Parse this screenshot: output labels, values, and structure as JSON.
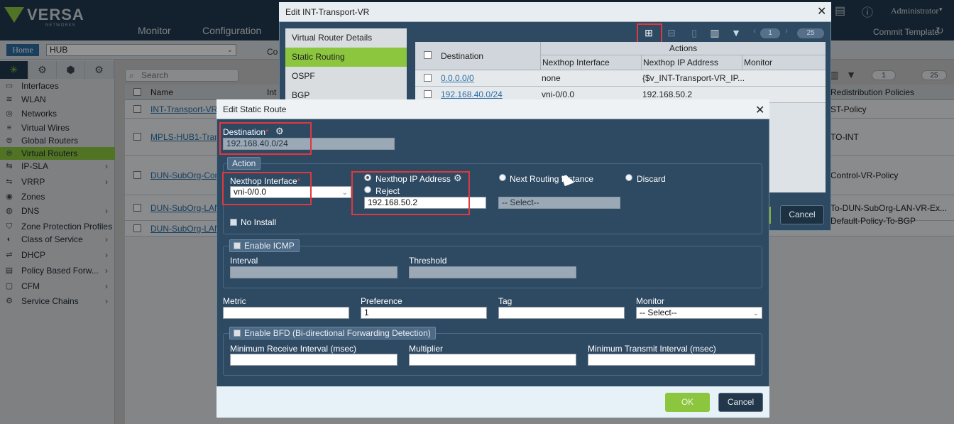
{
  "app": {
    "logo_text": "VERSA",
    "logo_sub": "NETWORKS",
    "nav": [
      "Monitor",
      "Configuration"
    ],
    "user": "Administrator",
    "commit_template": "Commit Template",
    "home": "Home",
    "org": "HUB",
    "context_partial": "Co"
  },
  "sidebar": {
    "items": [
      {
        "label": "Interfaces",
        "icon": "interfaces-icon",
        "expandable": false
      },
      {
        "label": "WLAN",
        "icon": "wifi-icon",
        "expandable": false
      },
      {
        "label": "Networks",
        "icon": "network-icon",
        "expandable": false
      },
      {
        "label": "Virtual Wires",
        "icon": "wire-icon",
        "expandable": false
      },
      {
        "label": "Global Routers",
        "icon": "router-icon",
        "expandable": false
      },
      {
        "label": "Virtual Routers",
        "icon": "router-icon",
        "expandable": false,
        "active": true
      },
      {
        "label": "IP-SLA",
        "icon": "sla-icon",
        "expandable": true
      },
      {
        "label": "VRRP",
        "icon": "vrrp-icon",
        "expandable": true
      },
      {
        "label": "Zones",
        "icon": "zones-icon",
        "expandable": false
      },
      {
        "label": "DNS",
        "icon": "dns-icon",
        "expandable": true
      },
      {
        "label": "Zone Protection Profiles",
        "icon": "shield-icon",
        "expandable": false
      },
      {
        "label": "Class of Service",
        "icon": "cos-icon",
        "expandable": true
      },
      {
        "label": "DHCP",
        "icon": "dhcp-icon",
        "expandable": true
      },
      {
        "label": "Policy Based Forw...",
        "icon": "policy-icon",
        "expandable": true
      },
      {
        "label": "CFM",
        "icon": "cfm-icon",
        "expandable": true
      },
      {
        "label": "Service Chains",
        "icon": "gear-icon",
        "expandable": true
      }
    ]
  },
  "main_list": {
    "search_placeholder": "Search",
    "col_name": "Name",
    "col_int_partial": "Int",
    "col_redistribution": "Redistribution Policies",
    "rows": [
      {
        "name": "INT-Transport-VR",
        "policy": "ST-Policy"
      },
      {
        "name": "MPLS-HUB1-Trans",
        "policy": "TO-INT"
      },
      {
        "name": "DUN-SubOrg-Con",
        "policy": "Control-VR-Policy"
      },
      {
        "name": "DUN-SubOrg-LAN",
        "policy": "To-DUN-SubOrg-LAN-VR-Ex..."
      },
      {
        "name": "DUN-SubOrg-LAN",
        "policy": "Default-Policy-To-BGP"
      },
      {
        "name": "",
        "policy": "Default-Policy"
      }
    ],
    "page_current": "1",
    "page_size": "25"
  },
  "vr_dialog": {
    "title": "Edit INT-Transport-VR",
    "nav": [
      "Virtual Router Details",
      "Static Routing",
      "OSPF",
      "BGP"
    ],
    "active_nav": "Static Routing",
    "toolbar": {
      "page": "1",
      "page_size": "25"
    },
    "grid": {
      "col_destination": "Destination",
      "group_actions": "Actions",
      "col_nexthop_interface": "Nexthop Interface",
      "col_nexthop_ip": "Nexthop IP Address",
      "col_monitor": "Monitor",
      "rows": [
        {
          "destination": "0.0.0.0/0",
          "interface": "none",
          "ip": "{$v_INT-Transport-VR_IP..."
        },
        {
          "destination": "192.168.40.0/24",
          "interface": "vni-0/0.0",
          "ip": "192.168.50.2"
        }
      ]
    },
    "cancel": "Cancel"
  },
  "static_route": {
    "title": "Edit Static Route",
    "destination_label": "Destination",
    "destination_value": "192.168.40.0/24",
    "action_label": "Action",
    "nexthop_interface_label": "Nexthop Interface",
    "nexthop_interface_value": "vni-0/0.0",
    "opt_nexthop_ip": "Nexthop IP Address",
    "opt_next_routing_instance": "Next Routing Instance",
    "opt_discard": "Discard",
    "opt_reject": "Reject",
    "nexthop_ip_value": "192.168.50.2",
    "routing_instance_placeholder": "-- Select--",
    "no_install": "No Install",
    "enable_icmp": "Enable ICMP",
    "interval": "Interval",
    "threshold": "Threshold",
    "metric": "Metric",
    "preference": "Preference",
    "preference_value": "1",
    "tag": "Tag",
    "monitor": "Monitor",
    "monitor_value": "-- Select--",
    "enable_bfd": "Enable BFD (Bi-directional Forwarding Detection)",
    "min_receive": "Minimum Receive Interval (msec)",
    "multiplier": "Multiplier",
    "min_transmit": "Minimum Transmit Interval (msec)",
    "ok": "OK",
    "cancel": "Cancel"
  }
}
